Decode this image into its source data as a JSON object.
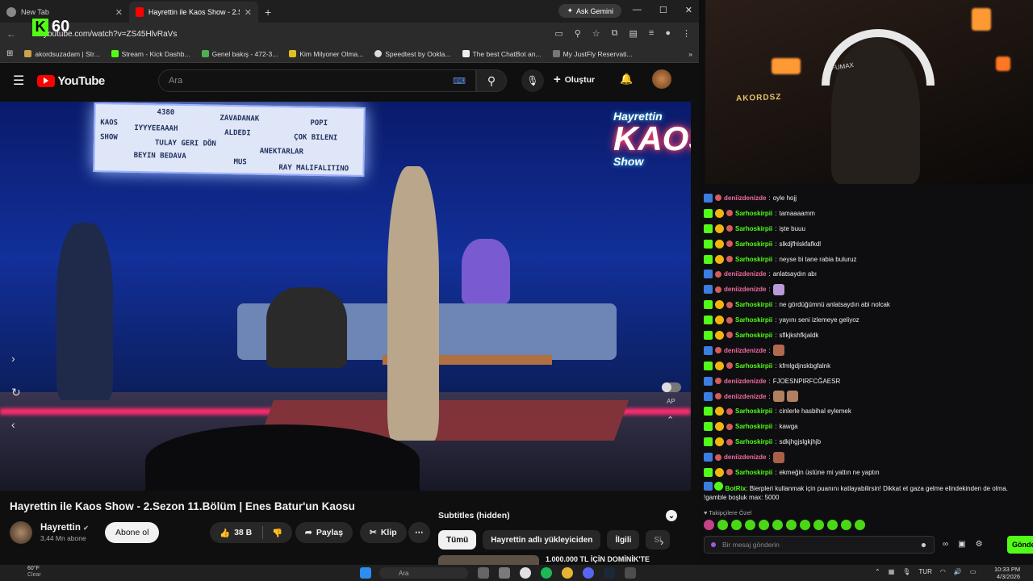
{
  "browser": {
    "tabs": [
      {
        "label": "New Tab",
        "active": false
      },
      {
        "label": "Hayrettin ile Kaos Show - 2.Sezon",
        "active": true
      }
    ],
    "gemini_label": "Ask Gemini",
    "url": "youtube.com/watch?v=ZS45HlvRaVs",
    "kick_viewers": "60",
    "bookmarks": [
      "akordsuzadam | Str...",
      "Stream - Kick Dashb...",
      "Genel bakış - 472-3...",
      "Kim Milyoner Olma...",
      "Speedtest by Ookla...",
      "The best ChatBot an...",
      "My JustFly Reservati..."
    ]
  },
  "youtube": {
    "logo": "YouTube",
    "search_placeholder": "Ara",
    "create_label": "Oluştur",
    "video": {
      "marquee": [
        "4380",
        "ZAVADANAK",
        "POPI",
        "KAOS",
        "IYYYEEAAAH",
        "ALDEDI",
        "ÇOK BILENI",
        "SHOW",
        "TULAY GERI DÖN",
        "ANEKTARLAR",
        "BEYIN BEDAVA",
        "MUS",
        "RAY MALIFALITINO"
      ],
      "neon_top": "Hayrettin",
      "neon_mid": "KAOS",
      "neon_bot": "Show",
      "ap_label": "AP"
    },
    "title": "Hayrettin ile Kaos Show - 2.Sezon 11.Bölüm | Enes Batur'un Kaosu",
    "channel": {
      "name": "Hayrettin",
      "subs": "3,44 Mn abone",
      "subscribe": "Abone ol"
    },
    "actions": {
      "likes": "38 B",
      "share": "Paylaş",
      "clip": "Klip",
      "more": "⋯"
    },
    "subtitles": "Subtitles (hidden)",
    "chips": [
      "Tümü",
      "Hayrettin adlı yükleyiciden",
      "İlgili",
      "Si"
    ],
    "up_next_title": "1.000.000 TL İÇİN DOMİNİK'TE"
  },
  "stream": {
    "webcam_logo": "AKORDSZ",
    "webcam_tag": "FUMAX",
    "colors": {
      "kick_green": "#53fc18",
      "user_green": "#53fc18",
      "user_pink": "#f06ba0"
    },
    "chat": [
      {
        "user": "deniizdenizde",
        "text": "oyle hojj",
        "color": "#f06ba0"
      },
      {
        "user": "Sarhoskirpii",
        "text": "tamaaaamm",
        "color": "#53fc18"
      },
      {
        "user": "Sarhoskirpii",
        "text": "işte buuu",
        "color": "#53fc18"
      },
      {
        "user": "Sarhoskirpii",
        "text": "slkdjfhlskfafkdl",
        "color": "#53fc18"
      },
      {
        "user": "Sarhoskirpii",
        "text": "neyse bi tane rabia buluruz",
        "color": "#53fc18"
      },
      {
        "user": "deniizdenizde",
        "text": "anlatsaydın abı",
        "color": "#f06ba0"
      },
      {
        "user": "deniizdenizde",
        "text": "",
        "color": "#f06ba0",
        "emote": "#b89ad8"
      },
      {
        "user": "Sarhoskirpii",
        "text": "ne gördüğümnü anlatsaydın abi nolcak",
        "color": "#53fc18"
      },
      {
        "user": "Sarhoskirpii",
        "text": "yayını seni izlemeye geliyoz",
        "color": "#53fc18"
      },
      {
        "user": "Sarhoskirpii",
        "text": "sflkjkshfkjaldk",
        "color": "#53fc18"
      },
      {
        "user": "deniizdenizde",
        "text": "",
        "color": "#f06ba0",
        "emote": "#b06a50"
      },
      {
        "user": "Sarhoskirpii",
        "text": "kfmlgdjnskbgfalnk",
        "color": "#53fc18"
      },
      {
        "user": "deniizdenizde",
        "text": "FJOESNPIRFCĞAESR",
        "color": "#f06ba0"
      },
      {
        "user": "deniizdenizde",
        "text": "",
        "color": "#f06ba0",
        "emote": "#b08060"
      },
      {
        "user": "Sarhoskirpii",
        "text": "cinlerle hasbihal eylemek",
        "color": "#53fc18"
      },
      {
        "user": "Sarhoskirpii",
        "text": "kawga",
        "color": "#53fc18"
      },
      {
        "user": "Sarhoskirpii",
        "text": "sdkjhgjslgkjhjb",
        "color": "#53fc18"
      },
      {
        "user": "deniizdenizde",
        "text": "",
        "color": "#f06ba0",
        "emote": "#a86048"
      },
      {
        "user": "Sarhoskirpii",
        "text": "ekmeğin üstüne mi yattın ne yaptın",
        "color": "#53fc18"
      }
    ],
    "bot": {
      "user": "BotRix",
      "text": "Bierpleri kullanmak için puanını katlayabilirsin! Dikkat et gaza gelme elindekinden de olma. !gamble boşluk max: 5000"
    },
    "followers_label": "Takipçilere Özel",
    "input_placeholder": "Bir mesaj gönderin",
    "send_label": "Gönder"
  },
  "taskbar": {
    "temp": "60°F",
    "weather": "Clear",
    "search": "Ara",
    "lang": "TUR",
    "time": "10:33 PM",
    "date": "4/3/2026"
  }
}
